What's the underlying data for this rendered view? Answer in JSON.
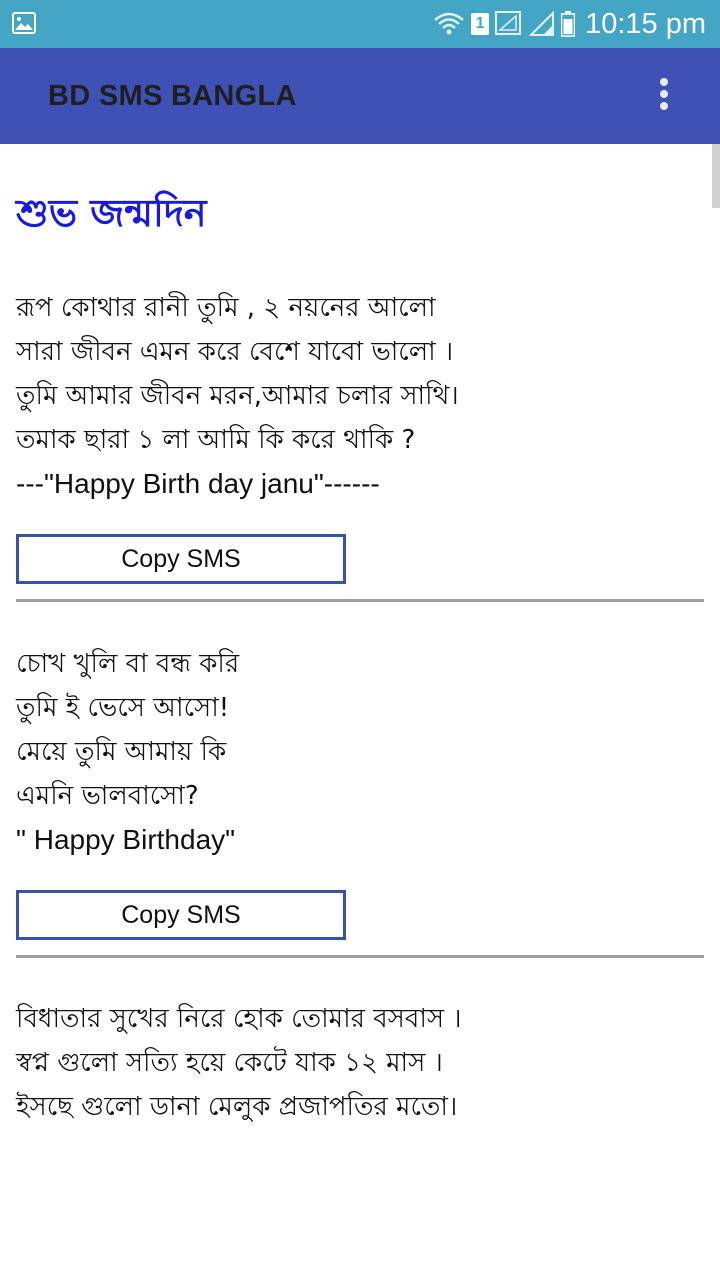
{
  "status_bar": {
    "time": "10:15 pm",
    "sim_number": "1",
    "icons": [
      "gallery-icon",
      "wifi-icon",
      "sim-icon",
      "signal-icon",
      "signal-icon-2",
      "battery-icon"
    ]
  },
  "app_bar": {
    "title": "BD SMS BANGLA",
    "menu_icon": "overflow-menu-icon"
  },
  "page": {
    "title": "শুভ জন্মদিন"
  },
  "sms_items": [
    {
      "lines": [
        "রূপ কোথার রানী তুমি , ২ নয়নের আলো",
        "সারা জীবন এমন করে বেশে যাবো ভালো ।",
        "তুমি আমার জীবন মরন,আমার চলার সাথি।",
        "তমাক ছারা ১ লা আমি কি করে থাকি ?",
        "---\"Happy Birth day janu\"------"
      ],
      "copy_label": "Copy SMS"
    },
    {
      "lines": [
        "চোখ খুলি বা বন্ধ করি",
        "তুমি ই ভেসে আসো!",
        "মেয়ে তুমি আমায় কি",
        "এমনি ভালবাসো?",
        "\" Happy Birthday\""
      ],
      "copy_label": "Copy SMS"
    },
    {
      "lines": [
        "বিধাতার সুখের নিরে হোক তোমার বসবাস ।",
        "স্বপ্ন গুলো সত্যি হয়ে কেটে যাক ১২ মাস ।",
        "ইসছে গুলো ডানা মেলুক প্রজাপতির মতো।"
      ]
    }
  ],
  "colors": {
    "status_bar": "#45a5c5",
    "app_bar": "#3f51b5",
    "title_text": "#1a1adf",
    "button_border": "#3653a8"
  }
}
